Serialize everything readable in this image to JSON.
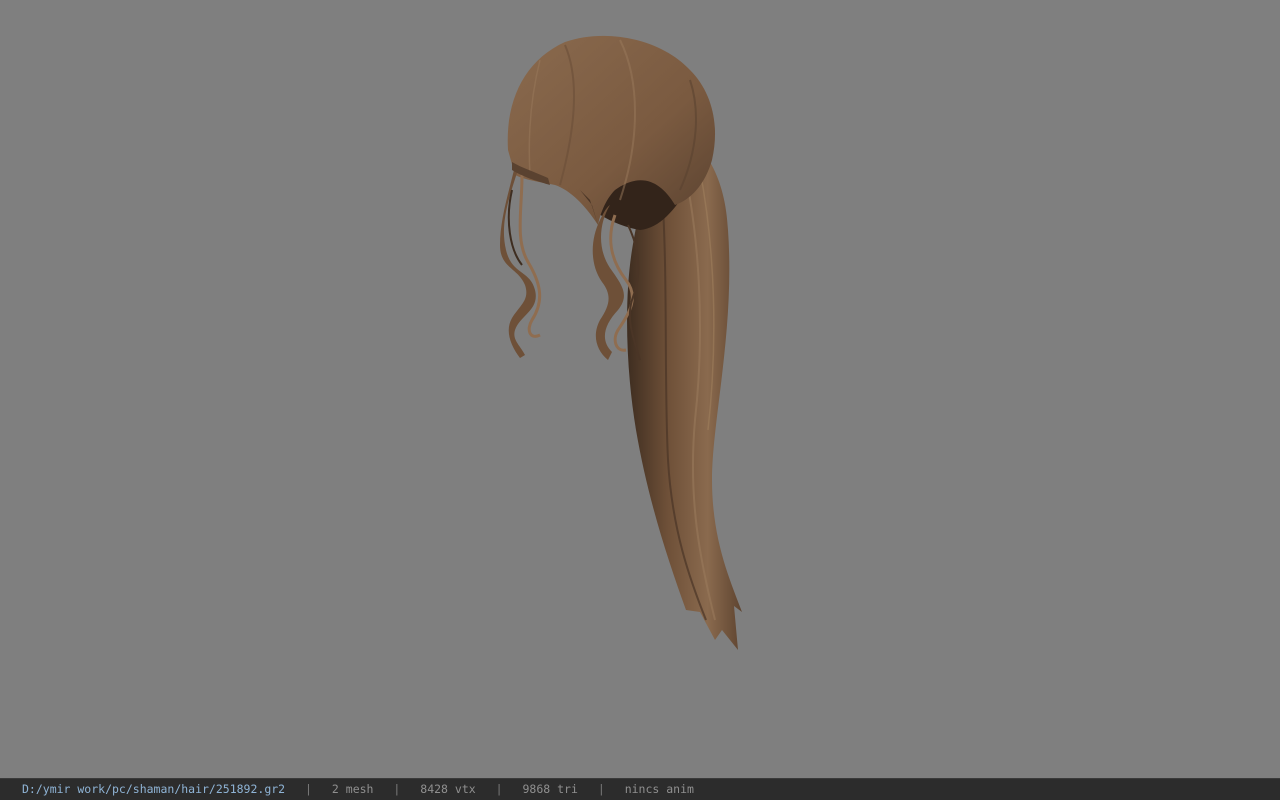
{
  "viewport": {
    "background_color": "#7f7f7f",
    "model_icon": "hair-model-icon",
    "hair_colors": {
      "base": "#7a5a40",
      "light": "#8f6d50",
      "shadow": "#4a3526",
      "dark": "#33241a"
    }
  },
  "status_bar": {
    "file_path": "D:/ymir work/pc/shaman/hair/251892.gr2",
    "separator": "|",
    "mesh_count": "2 mesh",
    "vertex_count": "8428 vtx",
    "triangle_count": "9868 tri",
    "animation": "nincs anim",
    "path_color": "#8fb4d6",
    "background_color": "#2c2c2c"
  }
}
